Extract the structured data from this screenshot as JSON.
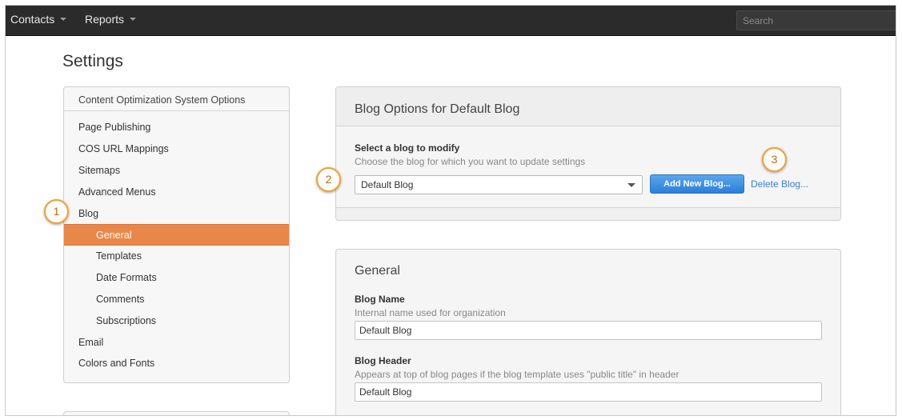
{
  "topnav": {
    "items": [
      {
        "label": "Contacts"
      },
      {
        "label": "Reports"
      }
    ],
    "search_placeholder": "Search"
  },
  "page_title": "Settings",
  "sidebar": {
    "header": "Content Optimization System Options",
    "items": [
      {
        "label": "Page Publishing",
        "sub": false,
        "active": false
      },
      {
        "label": "COS URL Mappings",
        "sub": false,
        "active": false
      },
      {
        "label": "Sitemaps",
        "sub": false,
        "active": false
      },
      {
        "label": "Advanced Menus",
        "sub": false,
        "active": false
      },
      {
        "label": "Blog",
        "sub": false,
        "active": false
      },
      {
        "label": "General",
        "sub": true,
        "active": true
      },
      {
        "label": "Templates",
        "sub": true,
        "active": false
      },
      {
        "label": "Date Formats",
        "sub": true,
        "active": false
      },
      {
        "label": "Comments",
        "sub": true,
        "active": false
      },
      {
        "label": "Subscriptions",
        "sub": true,
        "active": false
      },
      {
        "label": "Email",
        "sub": false,
        "active": false
      },
      {
        "label": "Colors and Fonts",
        "sub": false,
        "active": false
      }
    ]
  },
  "blog_options": {
    "title": "Blog Options for Default Blog",
    "select_label": "Select a blog to modify",
    "select_help": "Choose the blog for which you want to update settings",
    "select_value": "Default Blog",
    "add_button": "Add New Blog...",
    "delete_link": "Delete Blog..."
  },
  "general": {
    "title": "General",
    "blog_name_label": "Blog Name",
    "blog_name_help": "Internal name used for organization",
    "blog_name_value": "Default Blog",
    "blog_header_label": "Blog Header",
    "blog_header_help": "Appears at top of blog pages if the blog template uses \"public title\" in header",
    "blog_header_value": "Default Blog"
  },
  "callouts": [
    "1",
    "2",
    "3"
  ],
  "colors": {
    "nav_bg": "#2b2b2b",
    "active_item": "#e8874a",
    "primary_button": "#2b7fd8",
    "link": "#3b7fd0",
    "callout_border": "#f0a13c"
  }
}
